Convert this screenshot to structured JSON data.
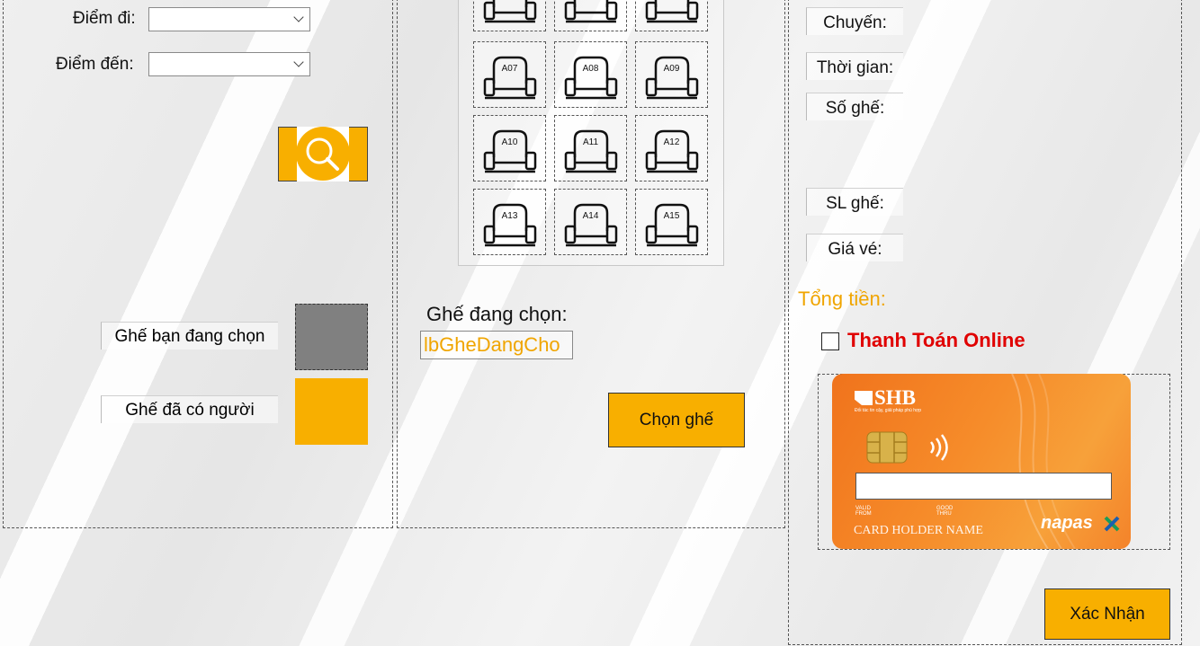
{
  "search": {
    "from_label": "Điểm đi:",
    "from_value": "",
    "to_label": "Điểm đến:",
    "to_value": "",
    "button_icon": "search-icon"
  },
  "legend": {
    "selected_label": "Ghế bạn đang chọn",
    "selected_color": "#808080",
    "occupied_label": "Ghế đã có người",
    "occupied_color": "#f8af00"
  },
  "seats": {
    "rows": [
      [
        "",
        "",
        ""
      ],
      [
        "A07",
        "A08",
        "A09"
      ],
      [
        "A10",
        "A11",
        "A12"
      ],
      [
        "A13",
        "A14",
        "A15"
      ]
    ],
    "current_label": "Ghế đang chọn:",
    "current_value": "lbGheDangCho",
    "choose_button": "Chọn ghế"
  },
  "booking": {
    "trip_label": "Chuyến:",
    "time_label": "Thời gian:",
    "seat_no_label": "Số ghế:",
    "seat_count_label": "SL ghế:",
    "price_label": "Giá vé:",
    "total_label": "Tổng tiền:",
    "online_pay_label": "Thanh Toán Online",
    "online_pay_checked": false,
    "confirm_button": "Xác Nhận"
  },
  "card": {
    "bank": "SHB",
    "bank_tagline": "Đối tác tin cậy, giải pháp phù hợp",
    "valid_from": "VALID FROM",
    "good_thru": "GOOD THRU",
    "holder": "CARD HOLDER NAME",
    "network": "napas",
    "input_value": ""
  },
  "colors": {
    "accent": "#f8af00",
    "total": "#f0a500",
    "online": "#e00000"
  }
}
